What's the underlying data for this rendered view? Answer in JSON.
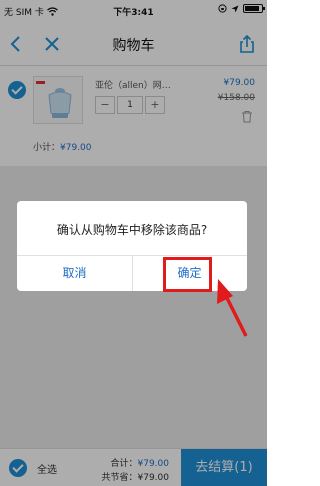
{
  "status_bar": {
    "carrier": "无 SIM 卡",
    "time": "下午3:41"
  },
  "nav": {
    "title": "购物车",
    "back_icon": "chevron-left-icon",
    "close_icon": "close-icon",
    "share_icon": "share-icon"
  },
  "cart_item": {
    "name": "亚伦（allen）网…",
    "price": "¥79.00",
    "original_price": "¥158.00",
    "quantity": "1",
    "minus": "−",
    "plus": "+",
    "subtotal_label": "小计：",
    "subtotal_value": "¥79.00"
  },
  "footer": {
    "select_all": "全选",
    "total_label": "合计：",
    "total_value": "¥79.00",
    "saved_label": "共节省：",
    "saved_value": "¥79.00",
    "checkout": "去结算(1)"
  },
  "dialog": {
    "message": "确认从购物车中移除该商品?",
    "cancel": "取消",
    "confirm": "确定"
  },
  "colors": {
    "accent": "#1e8fd8",
    "highlight": "#e11b1b"
  }
}
